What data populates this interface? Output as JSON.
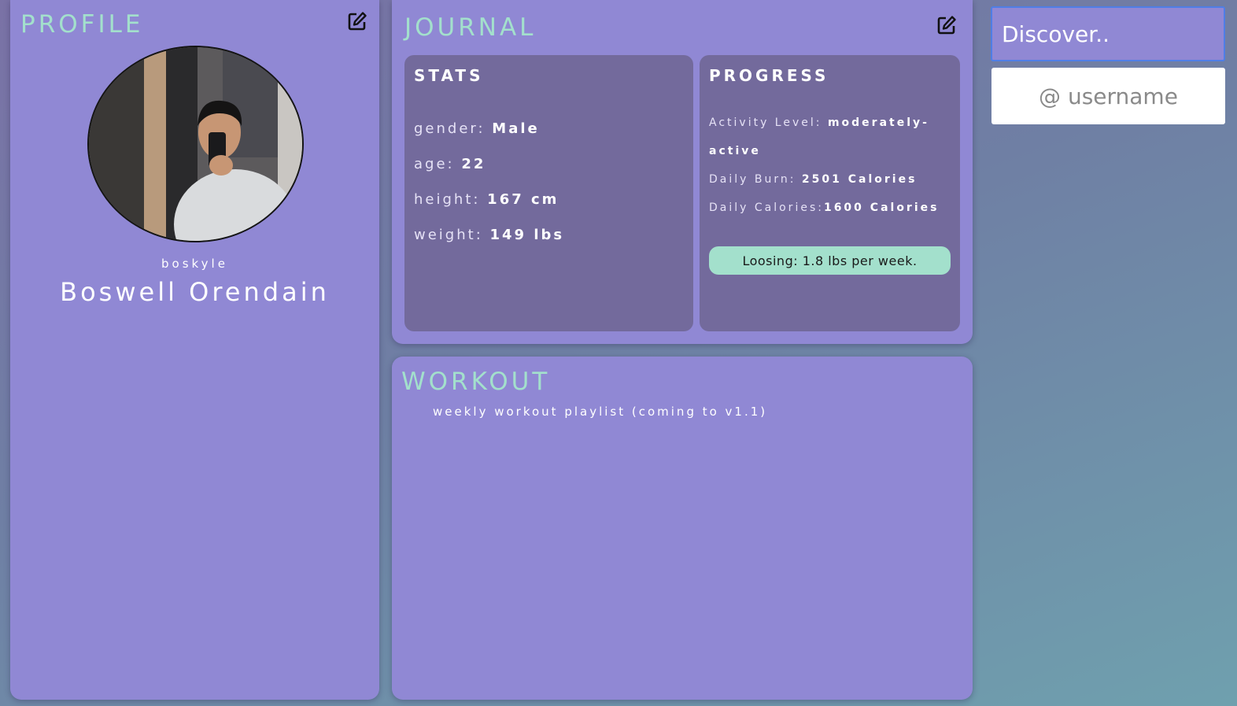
{
  "profile": {
    "title": "PROFILE",
    "edit_icon": "edit-square-icon",
    "handle": "boskyle",
    "full_name": "Boswell Orendain"
  },
  "journal": {
    "title": "JOURNAL",
    "edit_icon": "edit-square-icon",
    "stats": {
      "title": "STATS",
      "rows": [
        {
          "label": "gender: ",
          "value": "Male"
        },
        {
          "label": "age: ",
          "value": "22"
        },
        {
          "label": "height: ",
          "value": "167 cm"
        },
        {
          "label": "weight: ",
          "value": "149 lbs"
        }
      ]
    },
    "progress": {
      "title": "PROGRESS",
      "activity_label": "Activity Level: ",
      "activity_value_line1": "moderately-",
      "activity_value_line2": "active",
      "burn_label": "Daily Burn: ",
      "burn_value": "2501 Calories",
      "calories_label": "Daily Calories:",
      "calories_value": "1600 Calories",
      "loss_badge": "Loosing: 1.8 lbs per week."
    }
  },
  "workout": {
    "title": "WORKOUT",
    "note": "weekly workout playlist (coming to v1.1)"
  },
  "search": {
    "discover_placeholder": "Discover..",
    "username_placeholder": "@ username"
  },
  "colors": {
    "card": "#9088d4",
    "subcard": "#736a9c",
    "accent": "#a3e0cc",
    "focus_border": "#4f7ee6"
  }
}
